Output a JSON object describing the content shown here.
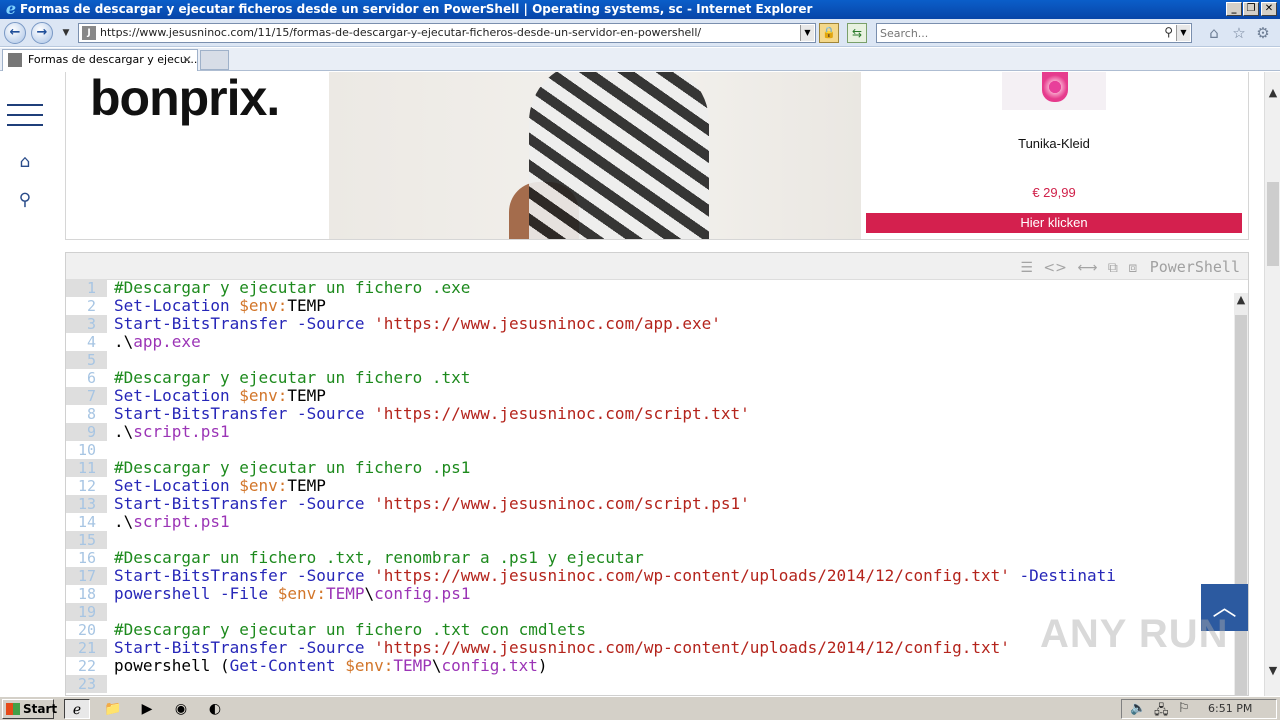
{
  "window": {
    "title": "Formas de descargar y ejecutar ficheros desde un servidor en PowerShell | Operating systems, sc - Internet Explorer",
    "minimize": "_",
    "restore": "❐",
    "close": "✕"
  },
  "addressbar": {
    "back": "←",
    "forward": "→",
    "url": "https://www.jesusninoc.com/11/15/formas-de-descargar-y-ejecutar-ficheros-desde-un-servidor-en-powershell/",
    "search_placeholder": "Search..."
  },
  "tab": {
    "label": "Formas de descargar y ejecu...",
    "close": "✕"
  },
  "toolbar_icons": [
    "home-icon",
    "star-icon",
    "gear-icon"
  ],
  "ad": {
    "brand": "bonprix.",
    "product_name": "Tunika-Kleid",
    "price": "€ 29,99",
    "cta": "Hier klicken"
  },
  "code": {
    "language": "PowerShell",
    "lines": [
      {
        "n": "1",
        "html": "<span class='tk-com'>#Descargar y ejecutar un fichero .exe</span>"
      },
      {
        "n": "2",
        "html": "<span class='tk-cmd'>Set-Location</span> <span class='tk-var'>$env:</span><span class='tk-plain'>TEMP</span>"
      },
      {
        "n": "3",
        "html": "<span class='tk-cmd'>Start-BitsTransfer</span> <span class='tk-cmd'>-Source</span> <span class='tk-str'>'https://www.jesusninoc.com/app.exe'</span>"
      },
      {
        "n": "4",
        "html": "<span class='tk-plain'>.\\</span><span class='tk-path'>app.exe</span>"
      },
      {
        "n": "5",
        "html": ""
      },
      {
        "n": "6",
        "html": "<span class='tk-com'>#Descargar y ejecutar un fichero .txt</span>"
      },
      {
        "n": "7",
        "html": "<span class='tk-cmd'>Set-Location</span> <span class='tk-var'>$env:</span><span class='tk-plain'>TEMP</span>"
      },
      {
        "n": "8",
        "html": "<span class='tk-cmd'>Start-BitsTransfer</span> <span class='tk-cmd'>-Source</span> <span class='tk-str'>'https://www.jesusninoc.com/script.txt'</span>"
      },
      {
        "n": "9",
        "html": "<span class='tk-plain'>.\\</span><span class='tk-path'>script.ps1</span>"
      },
      {
        "n": "10",
        "html": ""
      },
      {
        "n": "11",
        "html": "<span class='tk-com'>#Descargar y ejecutar un fichero .ps1</span>"
      },
      {
        "n": "12",
        "html": "<span class='tk-cmd'>Set-Location</span> <span class='tk-var'>$env:</span><span class='tk-plain'>TEMP</span>"
      },
      {
        "n": "13",
        "html": "<span class='tk-cmd'>Start-BitsTransfer</span> <span class='tk-cmd'>-Source</span> <span class='tk-str'>'https://www.jesusninoc.com/script.ps1'</span>"
      },
      {
        "n": "14",
        "html": "<span class='tk-plain'>.\\</span><span class='tk-path'>script.ps1</span>"
      },
      {
        "n": "15",
        "html": ""
      },
      {
        "n": "16",
        "html": "<span class='tk-com'>#Descargar un fichero .txt, renombrar a .ps1 y ejecutar</span>"
      },
      {
        "n": "17",
        "html": "<span class='tk-cmd'>Start-BitsTransfer</span> <span class='tk-cmd'>-Source</span> <span class='tk-str'>'https://www.jesusninoc.com/wp-content/uploads/2014/12/config.txt'</span> <span class='tk-cmd'>-Destinati</span>"
      },
      {
        "n": "18",
        "html": "<span class='tk-cmd'>powershell</span> <span class='tk-cmd'>-File</span> <span class='tk-var'>$env:</span><span class='tk-path'>TEMP</span><span class='tk-plain'>\\</span><span class='tk-path'>config.ps1</span>"
      },
      {
        "n": "19",
        "html": ""
      },
      {
        "n": "20",
        "html": "<span class='tk-com'>#Descargar y ejecutar un fichero .txt con cmdlets</span>"
      },
      {
        "n": "21",
        "html": "<span class='tk-cmd'>Start-BitsTransfer</span> <span class='tk-cmd'>-Source</span> <span class='tk-str'>'https://www.jesusninoc.com/wp-content/uploads/2014/12/config.txt'</span>"
      },
      {
        "n": "22",
        "html": "<span class='tk-plain'>powershell (</span><span class='tk-cmd'>Get-Content</span> <span class='tk-var'>$env:</span><span class='tk-path'>TEMP</span><span class='tk-plain'>\\</span><span class='tk-path'>config.txt</span><span class='tk-plain'>)</span>"
      },
      {
        "n": "23",
        "html": ""
      }
    ]
  },
  "watermark": "ANY RUN",
  "taskbar": {
    "start": "Start",
    "clock": "6:51 PM"
  }
}
